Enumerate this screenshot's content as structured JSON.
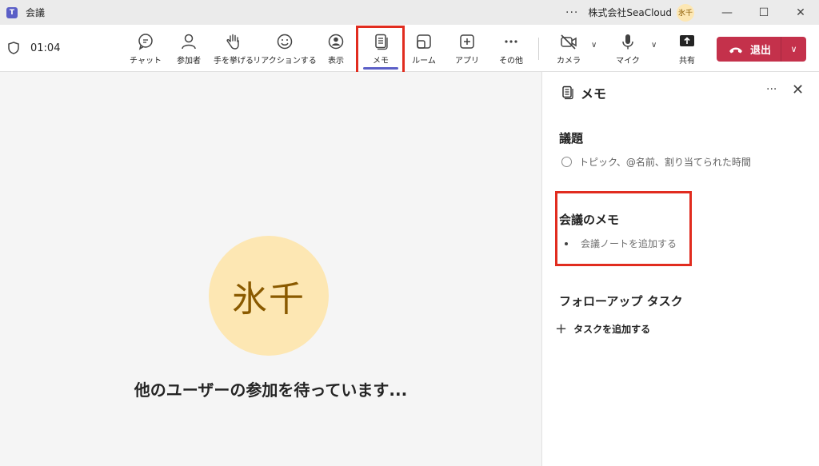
{
  "titlebar": {
    "app_icon": "teams-icon",
    "app_icon_text": "T",
    "title": "会議",
    "more": "···",
    "org_name": "株式会社SeaCloud",
    "avatar_initials": "氷千",
    "minimize": "—",
    "maximize": "☐",
    "close": "✕"
  },
  "toolbar": {
    "timer": "01:04",
    "items": [
      {
        "label": "チャット",
        "icon": "chat-icon"
      },
      {
        "label": "参加者",
        "icon": "people-icon"
      },
      {
        "label": "手を挙げる",
        "icon": "raise-hand-icon"
      },
      {
        "label": "リアクションする",
        "icon": "reaction-icon"
      },
      {
        "label": "表示",
        "icon": "view-icon"
      },
      {
        "label": "メモ",
        "icon": "notes-icon"
      },
      {
        "label": "ルーム",
        "icon": "rooms-icon"
      },
      {
        "label": "アプリ",
        "icon": "apps-icon"
      },
      {
        "label": "その他",
        "icon": "more-icon"
      },
      {
        "label": "カメラ",
        "icon": "camera-off-icon"
      },
      {
        "label": "マイク",
        "icon": "mic-icon"
      },
      {
        "label": "共有",
        "icon": "share-icon"
      }
    ],
    "leave_label": "退出",
    "accent": "#5b5fc7",
    "leave_color": "#c4314b"
  },
  "stage": {
    "avatar_initials": "氷千",
    "waiting_text": "他のユーザーの参加を待っています..."
  },
  "panel": {
    "title": "メモ",
    "more": "···",
    "close": "✕",
    "agenda_title": "議題",
    "agenda_placeholder": "トピック、@名前、割り当てられた時間",
    "notes_title": "会議のメモ",
    "notes_placeholder": "会議ノートを追加する",
    "tasks_title": "フォローアップ タスク",
    "add_task": "タスクを追加する"
  },
  "highlight_color": "#e12c1f"
}
